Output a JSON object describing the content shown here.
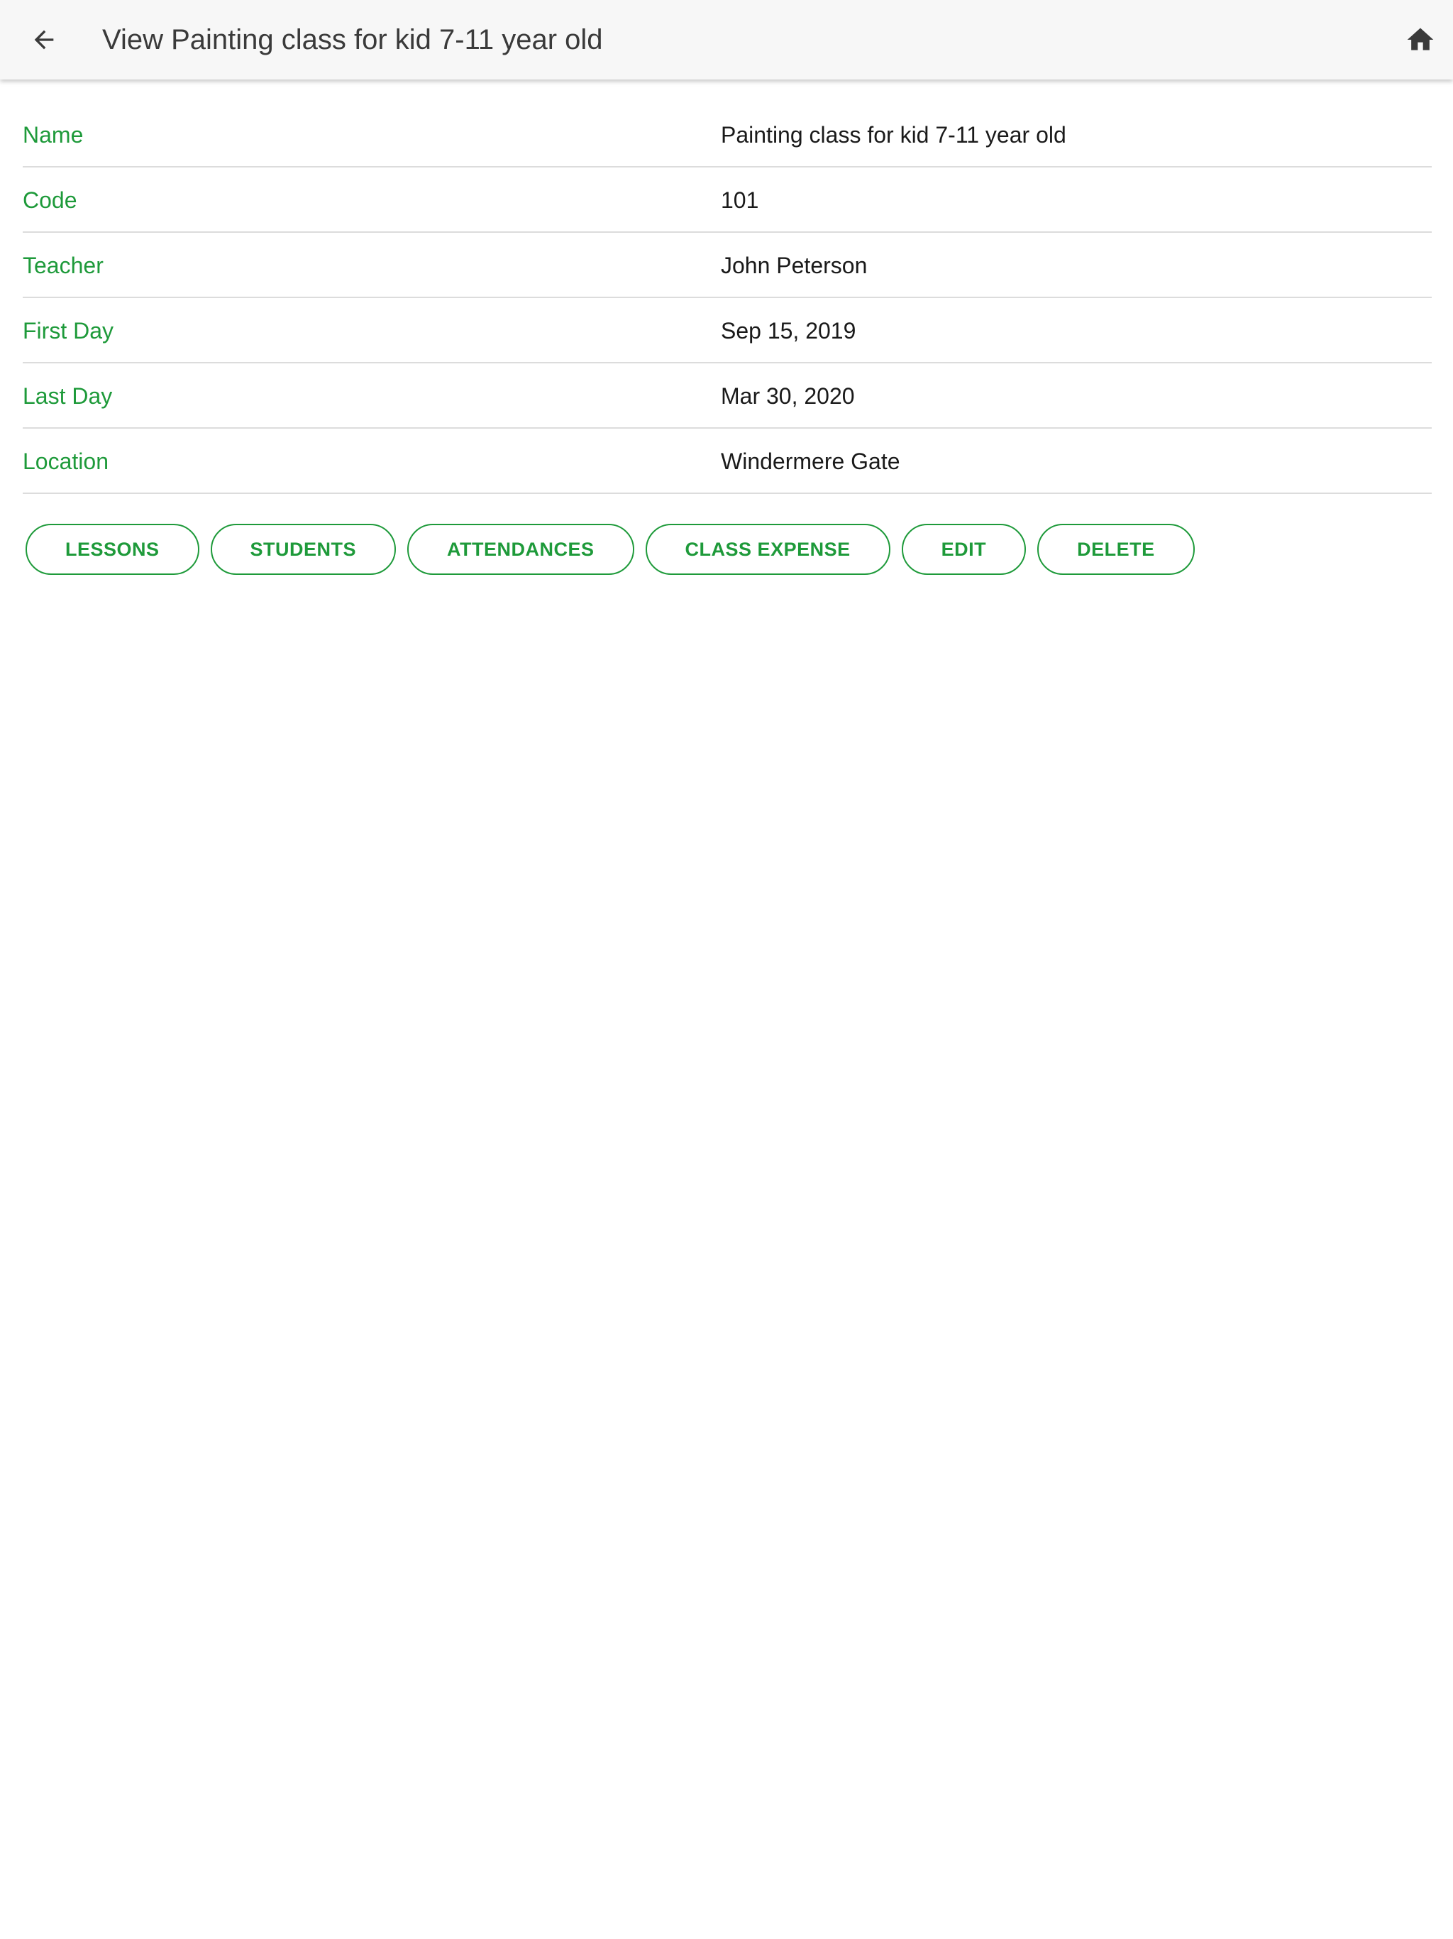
{
  "header": {
    "title": "View Painting class for kid 7-11 year old",
    "back_icon": "arrow-left-icon",
    "home_icon": "home-icon"
  },
  "details": [
    {
      "label": "Name",
      "value": "Painting class for kid 7-11 year old"
    },
    {
      "label": "Code",
      "value": "101"
    },
    {
      "label": "Teacher",
      "value": "John Peterson"
    },
    {
      "label": "First Day",
      "value": "Sep 15, 2019"
    },
    {
      "label": "Last Day",
      "value": "Mar 30, 2020"
    },
    {
      "label": "Location",
      "value": "Windermere Gate"
    }
  ],
  "actions": {
    "lessons": "LESSONS",
    "students": "STUDENTS",
    "attendances": "ATTENDANCES",
    "class_expense": "CLASS EXPENSE",
    "edit": "EDIT",
    "delete": "DELETE"
  },
  "colors": {
    "accent": "#1e9a3a",
    "app_bar": "#f7f7f7",
    "divider": "#dcdcdc"
  }
}
